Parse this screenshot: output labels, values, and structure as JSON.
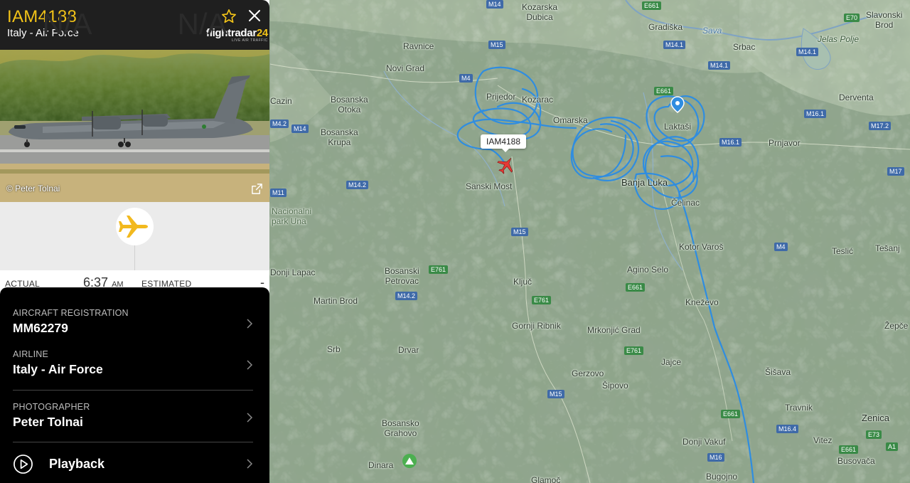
{
  "flight": {
    "callsign": "IAM4188",
    "operator": "Italy - Air Force",
    "photo_credit": "© Peter Tolnai",
    "origin": "N/A",
    "destination": "N/A",
    "actual_label": "ACTUAL",
    "actual_time": "6:37",
    "actual_ampm": "AM",
    "estimated_label": "ESTIMATED",
    "estimated_time": "-"
  },
  "brand": {
    "name_prefix": "flightradar",
    "name_suffix": "24",
    "tagline": "LIVE AIR TRAFFIC"
  },
  "details": [
    {
      "label": "AIRCRAFT REGISTRATION",
      "value": "MM62279"
    },
    {
      "label": "AIRLINE",
      "value": "Italy - Air Force"
    },
    {
      "label": "PHOTOGRAPHER",
      "value": "Peter Tolnai"
    }
  ],
  "playback": {
    "label": "Playback"
  },
  "map": {
    "aircraft_tag": "IAM4188",
    "places": {
      "kozarska_dubica": "Kozarska\nDubica",
      "gradiska": "Gradiška",
      "sava": "Sava",
      "srbac": "Srbac",
      "slavonski_brod": "Slavonski\nBrod",
      "jelas_polje": "Jelas Polje",
      "ravnice": "Ravnice",
      "novi_grad": "Novi Grad",
      "bosanska_otoka": "Bosanska\nOtoka",
      "cazin": "Cazin",
      "prijedor": "Prijedor",
      "kozarac": "Kozarac",
      "omarska": "Omarska",
      "laktasi": "Laktaši",
      "derventa": "Derventa",
      "bosanska_krupa": "Bosanska\nKrupa",
      "prnjavor": "Prnjavor",
      "sanski_most": "Sanski Most",
      "banja_luka": "Banja Luka",
      "celinac": "Čelinac",
      "nacionalni_park": "Nacionalni\npark Una",
      "kotor_varos": "Kotor Varoš",
      "teslic": "Teslić",
      "tesanj": "Tešanj",
      "donji_lapac": "Donji Lapac",
      "bosanski_petrovac": "Bosanski\nPetrovac",
      "kljuc": "Ključ",
      "agino_selo": "Agino Selo",
      "martin_brod": "Martin Brod",
      "knezevo": "Kneževo",
      "zepce": "Žepče",
      "gornji_ribnik": "Gornji Ribnik",
      "mrkonjic_grad": "Mrkonjić Grad",
      "srb": "Srb",
      "drvar": "Drvar",
      "jajce": "Jajce",
      "gerzovo": "Gerzovo",
      "sipovo": "Šipovo",
      "sisava": "Šišava",
      "travnik": "Travnik",
      "zenica": "Zenica",
      "bosansko_grahovo": "Bosansko\nGrahovo",
      "vitez": "Vitez",
      "donji_vakuf": "Donji Vakuf",
      "busovaca": "Busovača",
      "dinara": "Dinara",
      "bugojno": "Bugojno",
      "glamoc": "Glamoč"
    },
    "roads": {
      "m14_top": "M14",
      "e661_top": "E661",
      "e70": "E70",
      "m15_a": "M15",
      "m14_1_a": "M14.1",
      "m14_1_b": "M14.1",
      "m14_1_c": "M14.1",
      "m4_a": "M4",
      "e661_b": "E661",
      "m16_1_a": "M16.1",
      "m17_2": "M17.2",
      "m4_2": "M4.2",
      "m14_a": "M14",
      "m16_1_b": "M16.1",
      "m17": "M17",
      "m14_2_a": "M14.2",
      "m11": "M11",
      "m15_b": "M15",
      "m4_b": "M4",
      "e761_a": "E761",
      "e661_c": "E661",
      "m14_2_b": "M14.2",
      "e761_b": "E761",
      "e761_c": "E761",
      "m15_c": "M15",
      "e661_d": "E661",
      "m16_4": "M16.4",
      "e73": "E73",
      "e661_e": "E661",
      "a1": "A1",
      "m16": "M16"
    }
  },
  "colors": {
    "accent": "#f2c318",
    "track": "#2f8de0",
    "header_bg": "#1f1f1f",
    "details_bg": "#000000"
  }
}
